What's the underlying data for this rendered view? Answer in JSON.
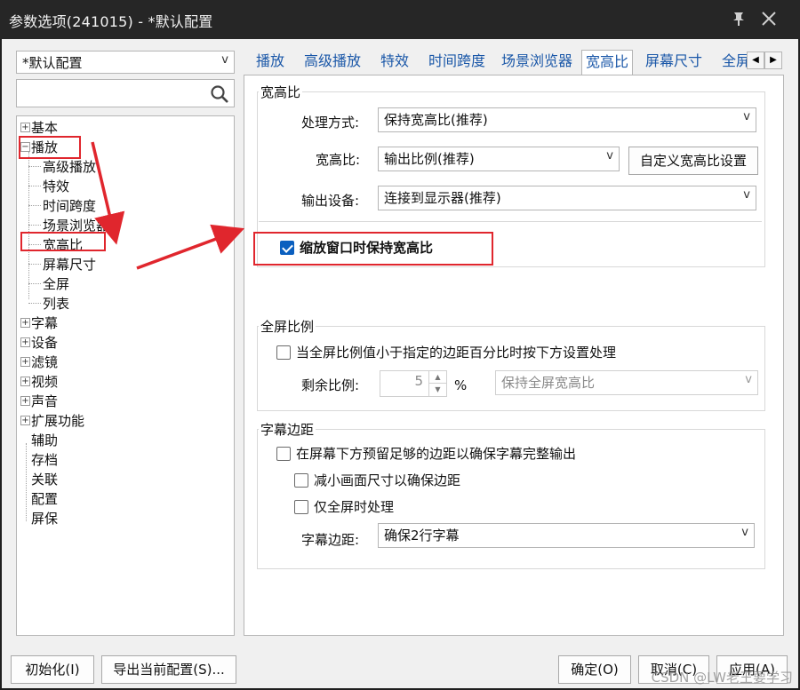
{
  "window": {
    "title": "参数选项(241015) - *默认配置"
  },
  "left": {
    "profile_value": "*默认配置",
    "search_placeholder": "",
    "tree": {
      "basic": "基本",
      "play": "播放",
      "play_children": [
        "高级播放",
        "特效",
        "时间跨度",
        "场景浏览器",
        "宽高比",
        "屏幕尺寸",
        "全屏",
        "列表"
      ],
      "subtitle": "字幕",
      "device": "设备",
      "filter": "滤镜",
      "video": "视频",
      "audio": "声音",
      "ext": "扩展功能",
      "assist": "辅助",
      "archive": "存档",
      "assoc": "关联",
      "config": "配置",
      "screensaver": "屏保"
    }
  },
  "tabs": [
    "播放",
    "高级播放",
    "特效",
    "时间跨度",
    "场景浏览器",
    "宽高比",
    "屏幕尺寸",
    "全屏"
  ],
  "aspect": {
    "group_title": "宽高比",
    "method_label": "处理方式:",
    "method_value": "保持宽高比(推荐)",
    "ratio_label": "宽高比:",
    "ratio_value": "输出比例(推荐)",
    "custom_button": "自定义宽高比设置",
    "device_label": "输出设备:",
    "device_value": "连接到显示器(推荐)",
    "keep_on_resize": "缩放窗口时保持宽高比",
    "keep_on_resize_checked": true
  },
  "fullscreen": {
    "group_title": "全屏比例",
    "check_label": "当全屏比例值小于指定的边距百分比时按下方设置处理",
    "remain_label": "剩余比例:",
    "remain_value": "5",
    "percent": "%",
    "mode_value": "保持全屏宽高比"
  },
  "subtitle_margin": {
    "group_title": "字幕边距",
    "reserve_label": "在屏幕下方预留足够的边距以确保字幕完整输出",
    "shrink_label": "减小画面尺寸以确保边距",
    "fullscreen_only_label": "仅全屏时处理",
    "margin_label": "字幕边距:",
    "margin_value": "确保2行字幕"
  },
  "buttons": {
    "init": "初始化(I)",
    "export": "导出当前配置(S)...",
    "ok": "确定(O)",
    "cancel": "取消(C)",
    "apply": "应用(A)"
  },
  "watermark": "CSDN @LW老王要学习",
  "colors": {
    "annotation_red": "#e0262d",
    "link_blue": "#1a57a8",
    "check_blue": "#0a5fbf"
  }
}
